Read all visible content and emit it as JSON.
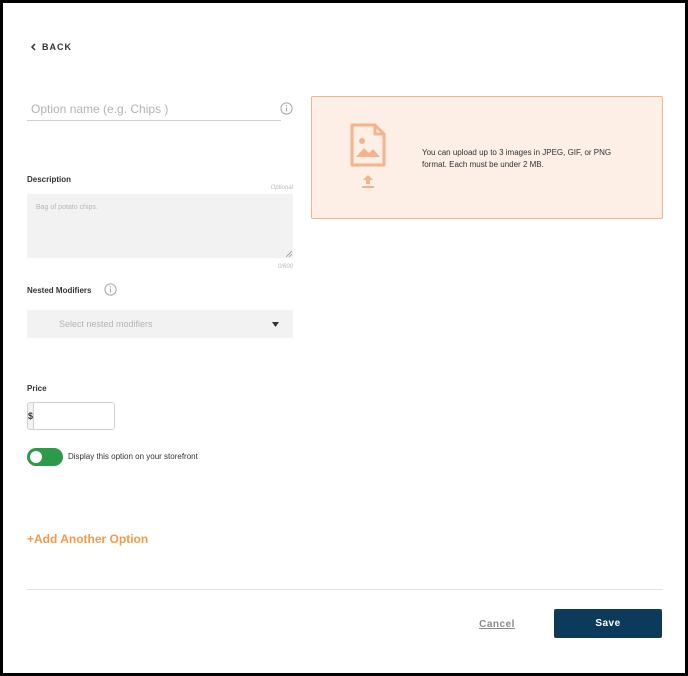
{
  "nav": {
    "back_label": "BACK"
  },
  "option": {
    "name_placeholder": "Option name (e.g. Chips )",
    "name_value": ""
  },
  "upload": {
    "text": "You can upload up to 3 images in JPEG, GIF, or PNG format. Each must be under 2 MB."
  },
  "description": {
    "label": "Description",
    "optional": "Optional",
    "placeholder": "Bag of potato chips.",
    "value": "",
    "char_count": "0/600"
  },
  "nested_modifiers": {
    "label": "Nested Modifiers",
    "placeholder": "Select nested modifiers"
  },
  "price": {
    "label": "Price",
    "currency_symbol": "$",
    "value": ""
  },
  "storefront_toggle": {
    "label": "Display this option on your storefront",
    "on": true
  },
  "add_option": {
    "label": "+Add Another Option"
  },
  "footer": {
    "cancel_label": "Cancel",
    "save_label": "Save"
  },
  "colors": {
    "accent_orange": "#f39a4a",
    "upload_bg": "#fdefe6",
    "upload_border": "#f4b38c",
    "toggle_green": "#2c9b48",
    "save_navy": "#0b3a5a"
  },
  "icons": {
    "back": "chevron-left-icon",
    "info": "info-icon",
    "image": "image-file-icon",
    "upload": "upload-arrow-icon",
    "caret": "caret-down-icon",
    "resize": "resize-handle-icon"
  }
}
